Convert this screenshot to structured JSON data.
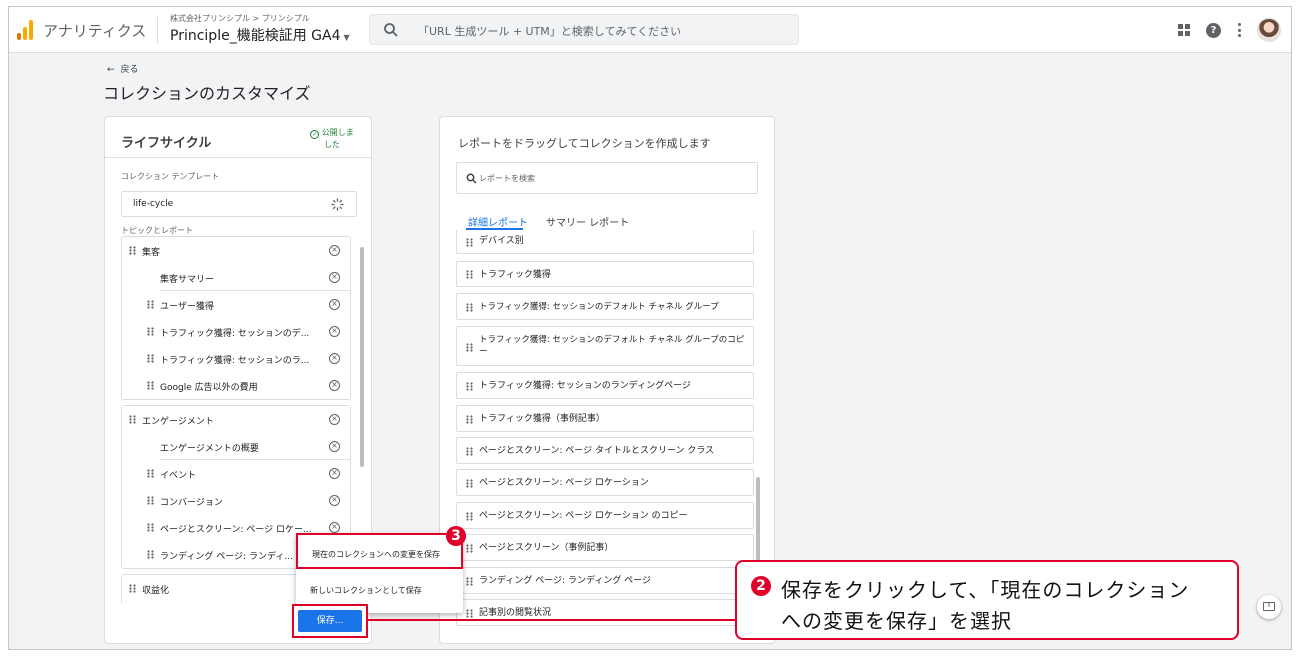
{
  "header": {
    "app_name": "アナリティクス",
    "breadcrumb": "株式会社プリンシプル > プリンシプル",
    "property_name": "Principle_機能検証用 GA4",
    "search_placeholder": "「URL 生成ツール + UTM」と検索してみてください",
    "icons": [
      "apps-icon",
      "help-icon",
      "more-vert-icon",
      "avatar"
    ]
  },
  "page": {
    "back_label": "戻る",
    "title": "コレクションのカスタマイズ"
  },
  "collection": {
    "name": "ライフサイクル",
    "status": "公開しました",
    "template_label": "コレクション テンプレート",
    "template_value": "life-cycle",
    "topics_label": "トピックとレポート",
    "groups": [
      {
        "items": [
          {
            "label": "集客",
            "level": 0
          },
          {
            "label": "集客サマリー",
            "level": 2
          },
          {
            "label": "ユーザー獲得",
            "level": 1
          },
          {
            "label": "トラフィック獲得: セッションのデ...",
            "level": 1
          },
          {
            "label": "トラフィック獲得: セッションのラ...",
            "level": 1
          },
          {
            "label": "Google 広告以外の費用",
            "level": 1
          }
        ]
      },
      {
        "items": [
          {
            "label": "エンゲージメント",
            "level": 0
          },
          {
            "label": "エンゲージメントの概要",
            "level": 2
          },
          {
            "label": "イベント",
            "level": 1
          },
          {
            "label": "コンバージョン",
            "level": 1
          },
          {
            "label": "ページとスクリーン: ページ ロケー...",
            "level": 1
          },
          {
            "label": "ランディング ページ: ランディ...",
            "level": 1
          }
        ]
      },
      {
        "items": [
          {
            "label": "収益化",
            "level": 0
          }
        ]
      }
    ]
  },
  "library": {
    "title": "レポートをドラッグしてコレクションを作成します",
    "search_placeholder": "レポートを検索",
    "tabs": [
      "詳細レポート",
      "サマリー レポート"
    ],
    "active_tab": 0,
    "reports": [
      "デバイス別",
      "トラフィック獲得",
      "トラフィック獲得: セッションのデフォルト チャネル グループ",
      "トラフィック獲得: セッションのデフォルト チャネル グループのコピー",
      "トラフィック獲得: セッションのランディングページ",
      "トラフィック獲得（事例記事）",
      "ページとスクリーン: ページ タイトルとスクリーン クラス",
      "ページとスクリーン: ページ ロケーション",
      "ページとスクリーン: ページ ロケーション のコピー",
      "ページとスクリーン（事例記事）",
      "ランディング ページ: ランディング ページ",
      "記事別の閲覧状況"
    ]
  },
  "save_menu": {
    "items": [
      "現在のコレクションへの変更を保存",
      "新しいコレクションとして保存"
    ],
    "button_label": "保存..."
  },
  "annotations": {
    "step3_badge": "3",
    "step2_badge": "2",
    "callout_line1": "保存をクリックして、「現在のコレクション",
    "callout_line2": "への変更を保存」を選択"
  },
  "colors": {
    "accent_blue": "#1a73e8",
    "annotation_red": "#e0002a",
    "published_green": "#188038",
    "logo_orange": "#f9ab00",
    "logo_dark_orange": "#e37400"
  }
}
